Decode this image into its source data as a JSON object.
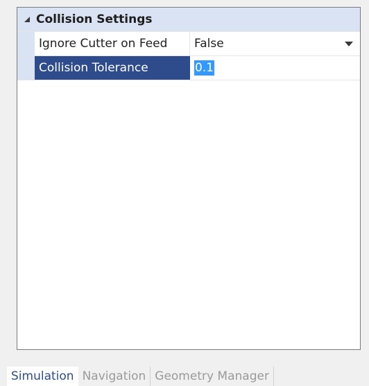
{
  "property_grid": {
    "category": {
      "label": "Collision Settings",
      "expanded": true,
      "icon": "collapse-triangle-icon"
    },
    "properties": [
      {
        "name": "Ignore Cutter on Feed",
        "value": "False",
        "editor": "dropdown",
        "selected": false
      },
      {
        "name": "Collision Tolerance",
        "value": "0.1",
        "editor": "text",
        "selected": true
      }
    ]
  },
  "tabs": [
    {
      "label": "Simulation",
      "active": true
    },
    {
      "label": "Navigation",
      "active": false
    },
    {
      "label": "Geometry Manager",
      "active": false
    }
  ],
  "colors": {
    "category_bg": "#d9e3f3",
    "selected_bg": "#2e4c8b",
    "text_selection_bg": "#3399ff",
    "active_tab_text": "#2e4c8b",
    "inactive_tab_text": "#9a9a9a"
  }
}
